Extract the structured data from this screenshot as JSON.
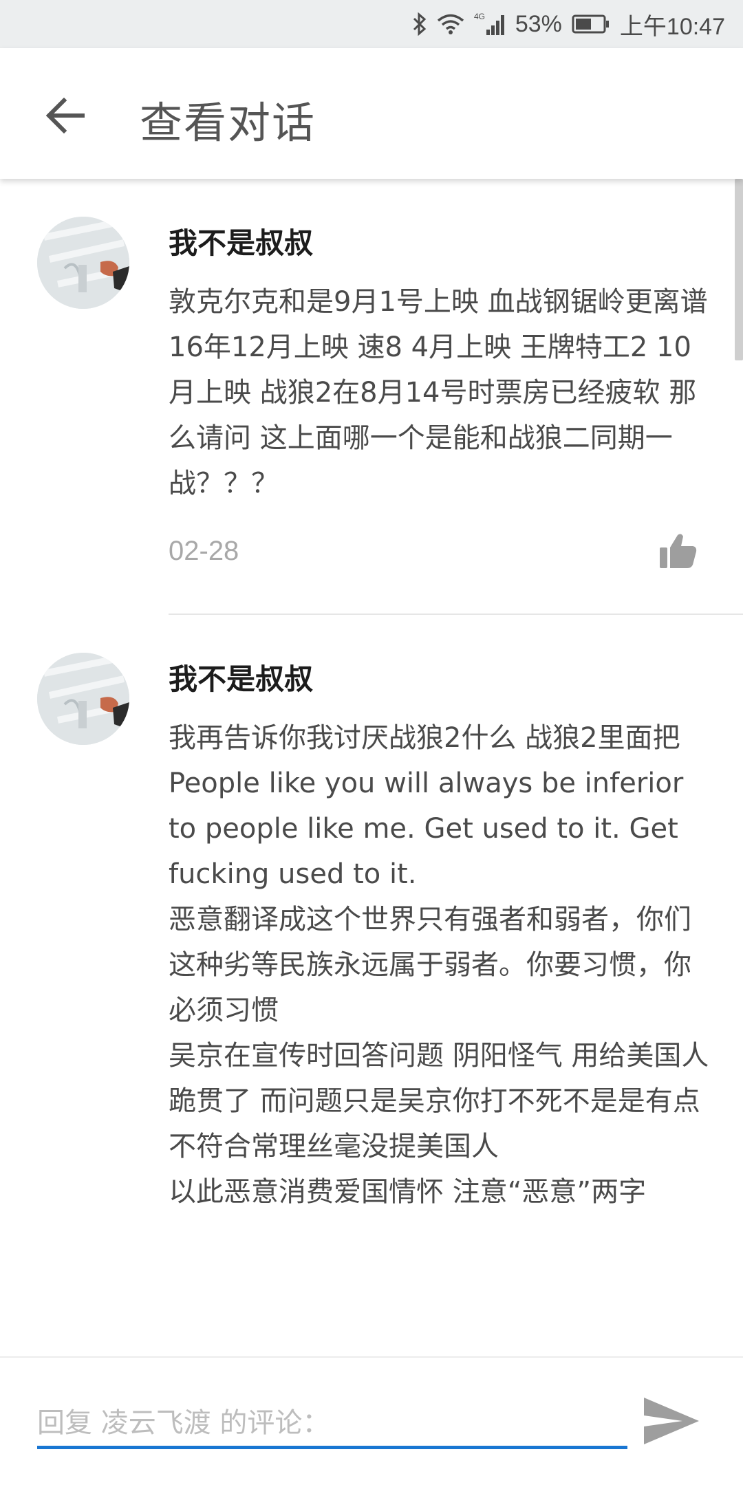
{
  "status_bar": {
    "network": "4G",
    "battery": "53%",
    "time": "上午10:47",
    "icons": [
      "bluetooth-icon",
      "wifi-icon",
      "signal-icon",
      "battery-icon"
    ]
  },
  "header": {
    "back_icon": "arrow-left-icon",
    "title": "查看对话"
  },
  "comments": [
    {
      "username": "我不是叔叔",
      "text": "敦克尔克和是9月1号上映 血战钢锯岭更离谱 16年12月上映 速8 4月上映 王牌特工2 10月上映 战狼2在8月14号时票房已经疲软 那么请问 这上面哪一个是能和战狼二同期一战？？？",
      "date": "02-28",
      "like_icon": "thumbs-up-icon"
    },
    {
      "username": "我不是叔叔",
      "text": "我再告诉你我讨厌战狼2什么 战狼2里面把\nPeople like you will always be inferior to people like me. Get used to it. Get fucking used to it.\n恶意翻译成这个世界只有强者和弱者，你们这种劣等民族永远属于弱者。你要习惯，你必须习惯\n吴京在宣传时回答问题 阴阳怪气 用给美国人跪贯了 而问题只是吴京你打不死不是是有点不符合常理丝毫没提美国人\n以此恶意消费爱国情怀 注意“恶意”两字"
    }
  ],
  "reply": {
    "placeholder": "回复 凌云飞渡 的评论：",
    "value": "",
    "send_icon": "send-icon"
  },
  "colors": {
    "accent": "#1976d2",
    "status_bar_bg": "#eceeef",
    "timestamp": "#a8a8a8",
    "icon_gray": "#9e9e9e"
  }
}
